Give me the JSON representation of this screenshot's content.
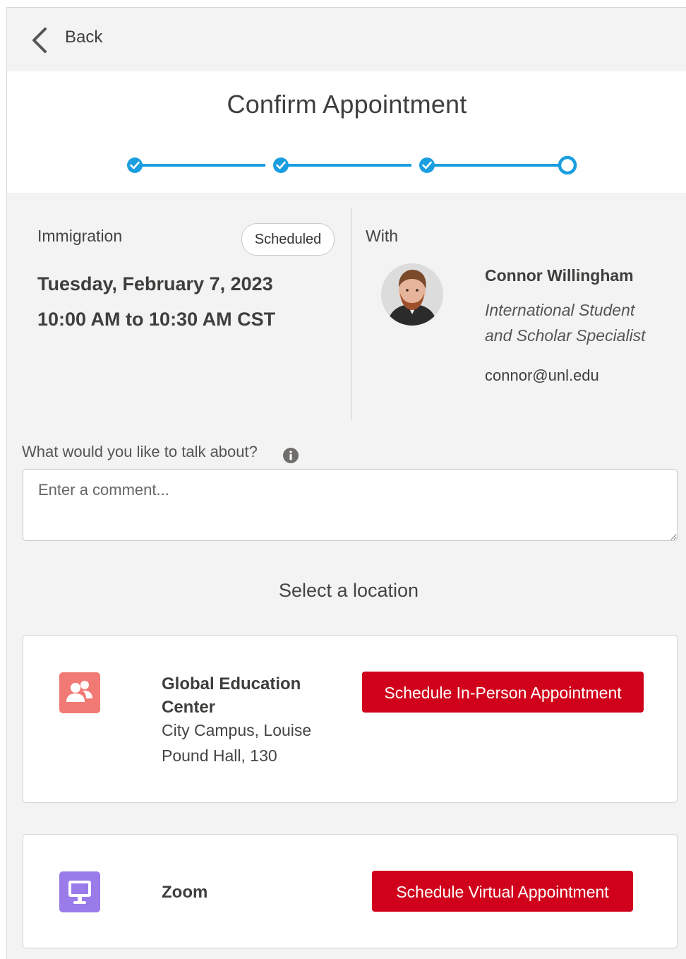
{
  "nav": {
    "back_label": "Back"
  },
  "page": {
    "title": "Confirm Appointment"
  },
  "stepper": {
    "total_steps": 4,
    "completed_steps": 3,
    "accent": "#1b9ee0"
  },
  "appointment": {
    "topic": "Immigration",
    "status": "Scheduled",
    "date": "Tuesday, February 7, 2023",
    "time": "10:00 AM to 10:30 AM CST"
  },
  "staff": {
    "with_label": "With",
    "name": "Connor Willingham",
    "title": "International Student and Scholar Specialist",
    "email": "connor@unl.edu"
  },
  "comment": {
    "label": "What would you like to talk about?",
    "placeholder": "Enter a comment...",
    "value": ""
  },
  "locations": {
    "heading": "Select a location",
    "items": [
      {
        "name": "Global Education Center",
        "address": "City Campus, Louise Pound Hall, 130",
        "icon": "in-person-icon",
        "icon_color": "#f27a75",
        "button_label": "Schedule In-Person Appointment"
      },
      {
        "name": "Zoom",
        "icon": "monitor-icon",
        "icon_color": "#9a7bea",
        "button_label": "Schedule Virtual Appointment"
      }
    ]
  },
  "colors": {
    "primary_button": "#d0021b",
    "background": "#f3f3f3"
  }
}
